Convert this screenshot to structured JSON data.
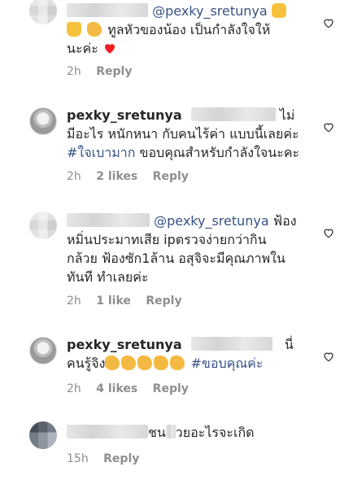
{
  "comments": [
    {
      "mention": "@pexky_sretunya",
      "line1_text": "ทูลหัวของน้อง เป็นกำลังใจให้",
      "line2_text": "นะค่ะ",
      "time": "2h",
      "reply": "Reply"
    },
    {
      "username": "pexky_sretunya",
      "text_after_name": "ไม่",
      "line2_text": "มีอะไร หนักหนา กับคนไร้ค่า แบบนี้เลยค่ะ",
      "hashtag": "#ใจเบามาก",
      "line3_text": " ขอบคุณสำหรับกำลังใจนะคะ",
      "time": "2h",
      "likes": "2 likes",
      "reply": "Reply"
    },
    {
      "mention": "@pexky_sretunya",
      "text_after_mention": " ฟ้อง",
      "line2_text": "หมิ่นประมาทเสีย ipตรวจง่ายกว่ากิน",
      "line3_text": "กล้วย ฟ้องซัก1ล้าน อสุจิจะมีคุณภาพใน",
      "line4_text": "ทันที ทำเลยค่ะ",
      "time": "2h",
      "likes": "1 like",
      "reply": "Reply"
    },
    {
      "username": "pexky_sretunya",
      "text_after_name": "นี่",
      "line2_prefix": "คนรู้จิง",
      "hashtag": "#ขอบคุณค่ะ",
      "time": "2h",
      "likes": "4 likes",
      "reply": "Reply"
    },
    {
      "text_fragments": [
        "ชน",
        "วยอะไรจะเกิด"
      ],
      "time": "15h",
      "reply": "Reply"
    }
  ],
  "icons": {
    "like": "heart-outline-icon",
    "emoji_thumb": "thumbs-up-emoji",
    "emoji_horns": "sign-of-horns-emoji",
    "emoji_clap": "clapping-hands-emoji",
    "emoji_heart": "red-heart-emoji"
  },
  "colors": {
    "link": "#385185",
    "meta": "#8e8e8e",
    "text": "#262626",
    "heart_emoji": "#ed1c24"
  }
}
